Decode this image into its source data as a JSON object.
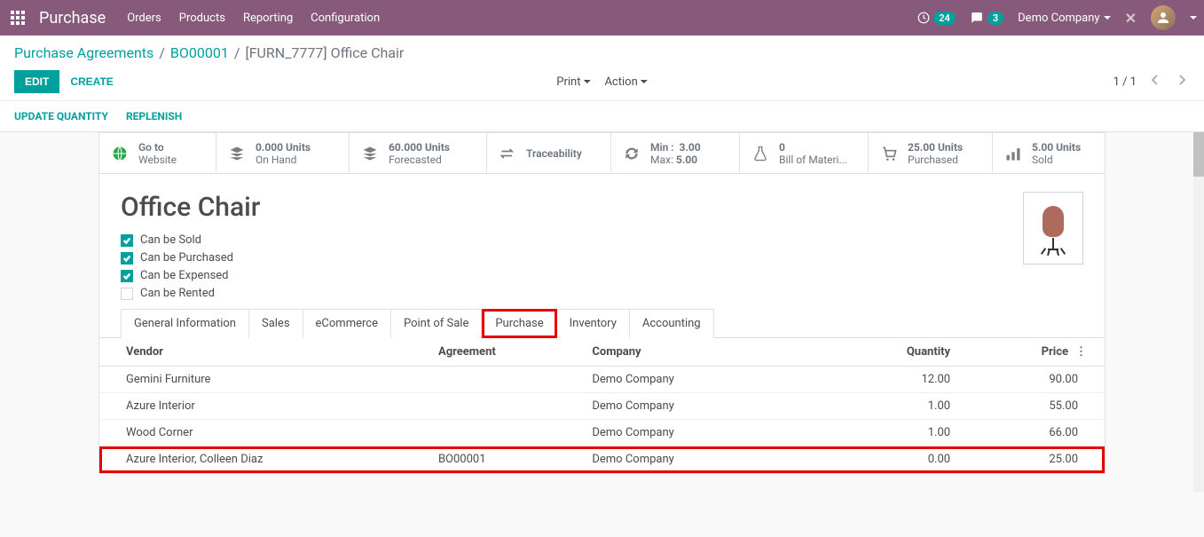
{
  "navbar": {
    "brand": "Purchase",
    "menu": [
      "Orders",
      "Products",
      "Reporting",
      "Configuration"
    ],
    "activity_count": "24",
    "message_count": "3",
    "company": "Demo Company"
  },
  "breadcrumb": {
    "items": [
      "Purchase Agreements",
      "BO00001"
    ],
    "current": "[FURN_7777] Office Chair"
  },
  "buttons": {
    "edit": "EDIT",
    "create": "CREATE",
    "print": "Print",
    "action": "Action"
  },
  "pager": {
    "text": "1 / 1"
  },
  "action_links": {
    "update_qty": "UPDATE QUANTITY",
    "replenish": "REPLENISH"
  },
  "stats": {
    "website": {
      "l1": "Go to",
      "l2": "Website"
    },
    "onhand": {
      "l1": "0.000 Units",
      "l2": "On Hand"
    },
    "forecast": {
      "l1": "60.000 Units",
      "l2": "Forecasted"
    },
    "trace": {
      "l1": "Traceability"
    },
    "minmax": {
      "min_lbl": "Min :",
      "min_val": "3.00",
      "max_lbl": "Max:",
      "max_val": "5.00"
    },
    "bom": {
      "l1": "0",
      "l2": "Bill of Materi..."
    },
    "purchased": {
      "l1": "25.00 Units",
      "l2": "Purchased"
    },
    "sold": {
      "l1": "5.00 Units",
      "l2": "Sold"
    }
  },
  "product": {
    "title": "Office Chair",
    "attrs": {
      "sold": "Can be Sold",
      "purchased": "Can be Purchased",
      "expensed": "Can be Expensed",
      "rented": "Can be Rented"
    }
  },
  "tabs": [
    "General Information",
    "Sales",
    "eCommerce",
    "Point of Sale",
    "Purchase",
    "Inventory",
    "Accounting"
  ],
  "table": {
    "headers": {
      "vendor": "Vendor",
      "agreement": "Agreement",
      "company": "Company",
      "qty": "Quantity",
      "price": "Price"
    },
    "rows": [
      {
        "vendor": "Gemini Furniture",
        "agreement": "",
        "company": "Demo Company",
        "qty": "12.00",
        "price": "90.00"
      },
      {
        "vendor": "Azure Interior",
        "agreement": "",
        "company": "Demo Company",
        "qty": "1.00",
        "price": "55.00"
      },
      {
        "vendor": "Wood Corner",
        "agreement": "",
        "company": "Demo Company",
        "qty": "1.00",
        "price": "66.00"
      },
      {
        "vendor": "Azure Interior, Colleen Diaz",
        "agreement": "BO00001",
        "company": "Demo Company",
        "qty": "0.00",
        "price": "25.00"
      }
    ]
  }
}
